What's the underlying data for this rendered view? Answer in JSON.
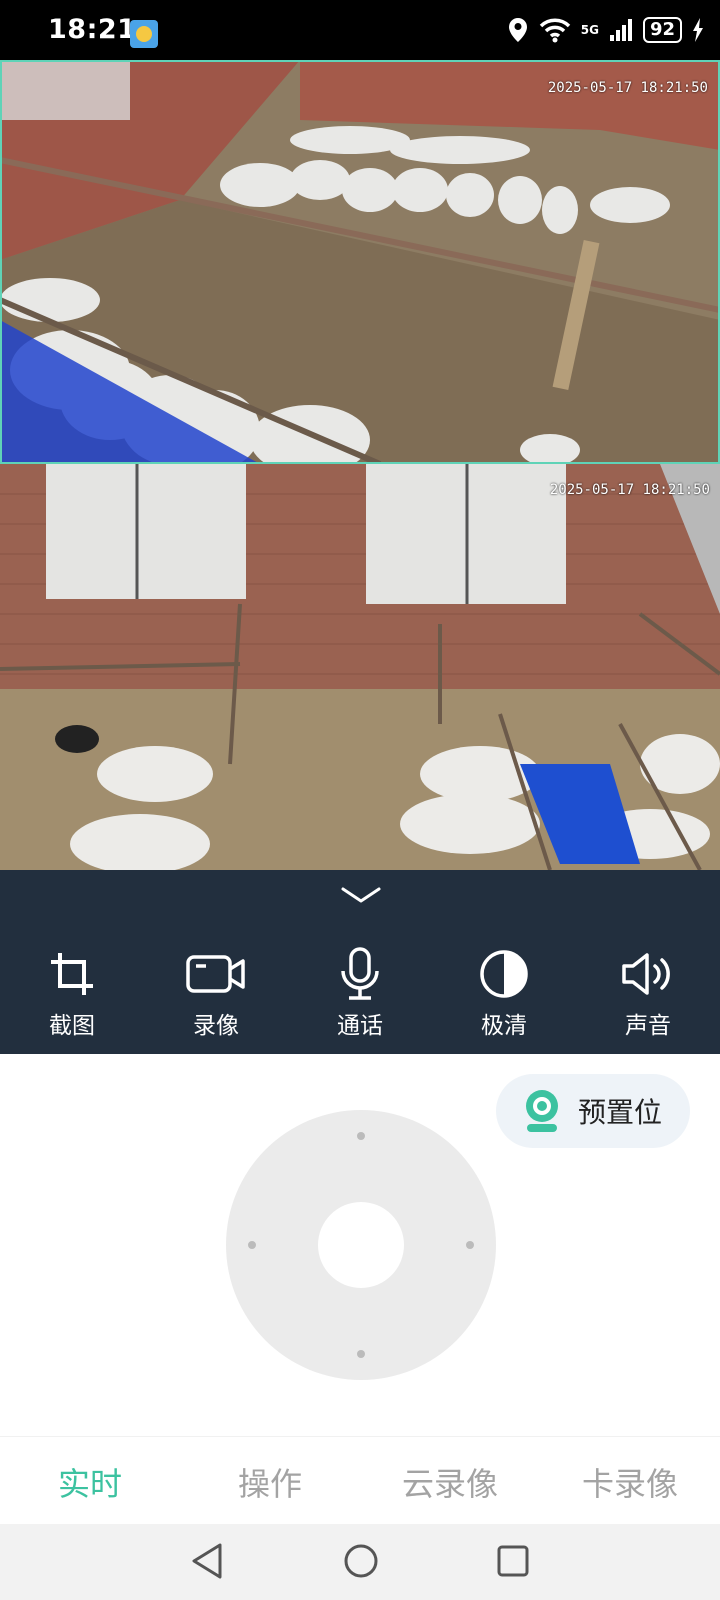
{
  "status_bar": {
    "time": "18:21",
    "network": "5G",
    "battery": "92"
  },
  "cameras": [
    {
      "timestamp": "2025-05-17 18:21:50",
      "selected": true
    },
    {
      "timestamp": "2025-05-17 18:21:50",
      "selected": false
    }
  ],
  "controls": [
    {
      "label": "截图",
      "icon": "crop-icon"
    },
    {
      "label": "录像",
      "icon": "video-camera-icon"
    },
    {
      "label": "通话",
      "icon": "microphone-icon"
    },
    {
      "label": "极清",
      "icon": "contrast-icon"
    },
    {
      "label": "声音",
      "icon": "speaker-icon"
    }
  ],
  "preset": {
    "label": "预置位",
    "icon": "webcam-icon"
  },
  "tabs": [
    {
      "label": "实时",
      "active": true
    },
    {
      "label": "操作",
      "active": false
    },
    {
      "label": "云录像",
      "active": false
    },
    {
      "label": "卡录像",
      "active": false
    }
  ],
  "colors": {
    "accent": "#3cc2a0",
    "control_bar": "#222f3e",
    "selected_border": "#5fd3b7"
  }
}
